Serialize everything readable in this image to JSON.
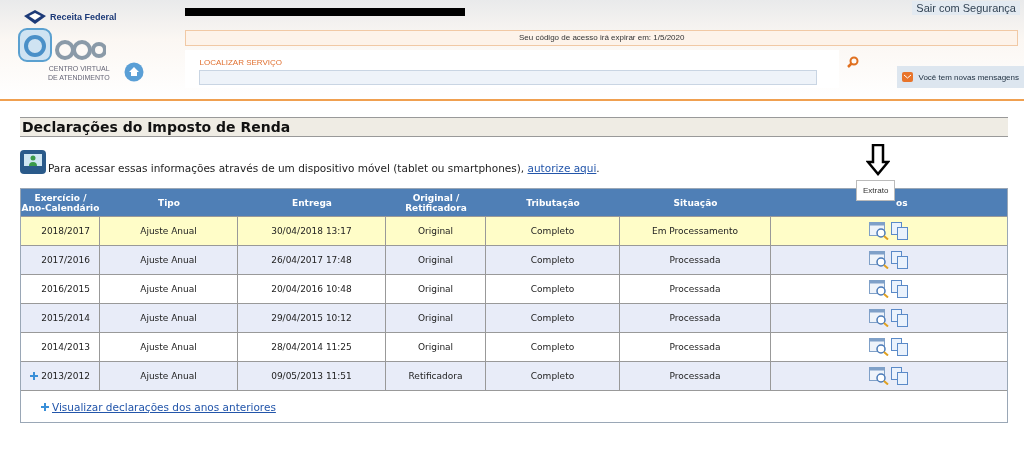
{
  "header": {
    "brand": "Receita Federal",
    "logo_subtitle": [
      "CENTRO VIRTUAL",
      "DE ATENDIMENTO"
    ],
    "logout": "Sair com Segurança",
    "notice": "Seu código de acesso irá expirar em: 1/5/2020",
    "search": {
      "label": "LOCALIZAR SERVIÇO"
    },
    "messages": "Você tem novas mensagens"
  },
  "section_title": "Declarações do Imposto de Renda",
  "mobile_notice": {
    "text": "Para acessar essas informações através de um dispositivo móvel (tablet ou smartphones), ",
    "link": "autorize aqui",
    "end": "."
  },
  "table": {
    "columns": [
      "Exercício /\nAno-Calendário",
      "Tipo",
      "Entrega",
      "Original /\nRetificadora",
      "Tributação",
      "Situação",
      "os"
    ],
    "rows": [
      {
        "cells": [
          "2018/2017",
          "Ajuste Anual",
          "30/04/2018 13:17",
          "Original",
          "Completo",
          "Em Processamento"
        ],
        "selected": true,
        "expandable": false
      },
      {
        "cells": [
          "2017/2016",
          "Ajuste Anual",
          "26/04/2017 17:48",
          "Original",
          "Completo",
          "Processada"
        ],
        "selected": false,
        "expandable": false
      },
      {
        "cells": [
          "2016/2015",
          "Ajuste Anual",
          "20/04/2016 10:48",
          "Original",
          "Completo",
          "Processada"
        ],
        "selected": false,
        "expandable": false
      },
      {
        "cells": [
          "2015/2014",
          "Ajuste Anual",
          "29/04/2015 10:12",
          "Original",
          "Completo",
          "Processada"
        ],
        "selected": false,
        "expandable": false
      },
      {
        "cells": [
          "2014/2013",
          "Ajuste Anual",
          "28/04/2014 11:25",
          "Original",
          "Completo",
          "Processada"
        ],
        "selected": false,
        "expandable": false
      },
      {
        "cells": [
          "2013/2012",
          "Ajuste Anual",
          "09/05/2013 11:51",
          "Retificadora",
          "Completo",
          "Processada"
        ],
        "selected": false,
        "expandable": true
      }
    ],
    "footer_link": "Visualizar declarações dos anos anteriores"
  },
  "tooltip": "Extrato"
}
